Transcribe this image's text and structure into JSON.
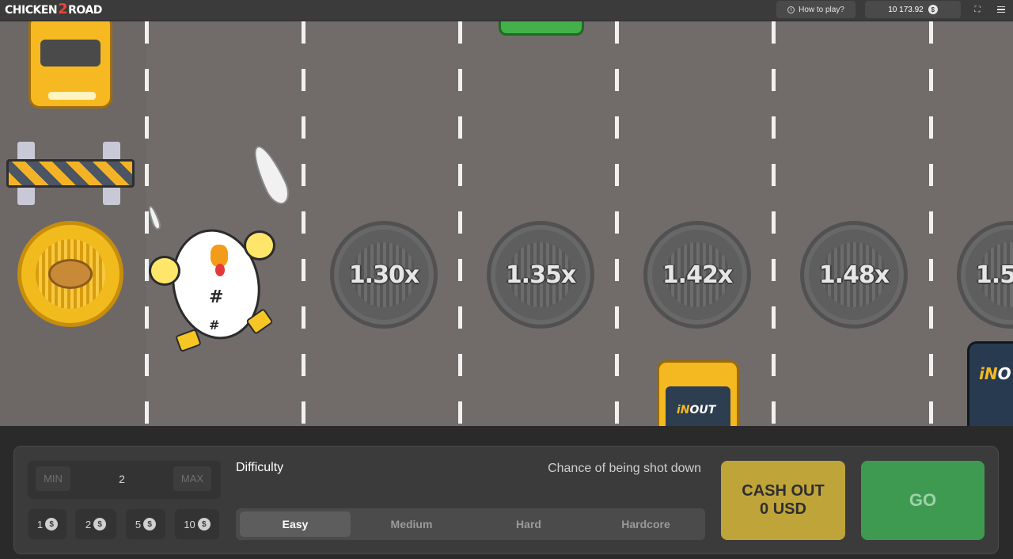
{
  "header": {
    "logo": {
      "part1": "CHICKEN",
      "part2": "2",
      "part3": "ROAD"
    },
    "how_to_play": "How to play?",
    "balance": "10 173.92",
    "currency_icon": "$"
  },
  "game": {
    "multipliers": [
      "1.30x",
      "1.35x",
      "1.42x",
      "1.48x",
      "1.5"
    ],
    "vehicle_brand": {
      "in": "iN",
      "out": "OUT"
    },
    "vehicle_brand_partial": {
      "in": "iN",
      "out": "O"
    }
  },
  "controls": {
    "bet": {
      "min_label": "MIN",
      "value": "2",
      "max_label": "MAX"
    },
    "quick_bets": [
      "1",
      "2",
      "5",
      "10"
    ],
    "difficulty_label": "Difficulty",
    "chance_label": "Chance of being shot down",
    "difficulty_options": [
      "Easy",
      "Medium",
      "Hard",
      "Hardcore"
    ],
    "selected_difficulty": "Easy",
    "cashout": {
      "line1": "CASH OUT",
      "line2": "0 USD"
    },
    "go_label": "GO"
  },
  "colors": {
    "road": "#716c6a",
    "cashout": "#bfa43a",
    "go": "#3f9a51",
    "panel": "#3b3b3b"
  }
}
